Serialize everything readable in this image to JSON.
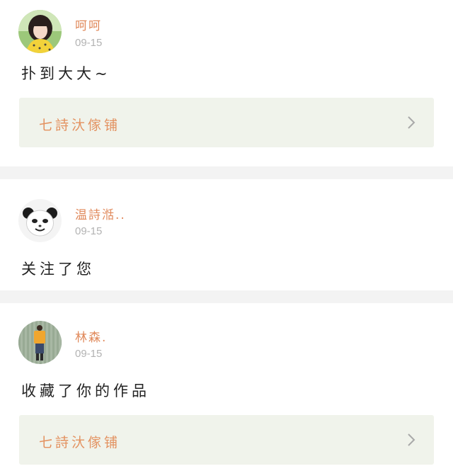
{
  "posts": [
    {
      "username": "呵呵",
      "date": "09-15",
      "message": "扑到大大~",
      "link_label": "七詩汏傢铺"
    },
    {
      "username": "温詩湉..",
      "date": "09-15",
      "message": "关注了您"
    },
    {
      "username": "林森.",
      "date": "09-15",
      "message": "收藏了你的作品",
      "link_label": "七詩汏傢铺"
    }
  ]
}
